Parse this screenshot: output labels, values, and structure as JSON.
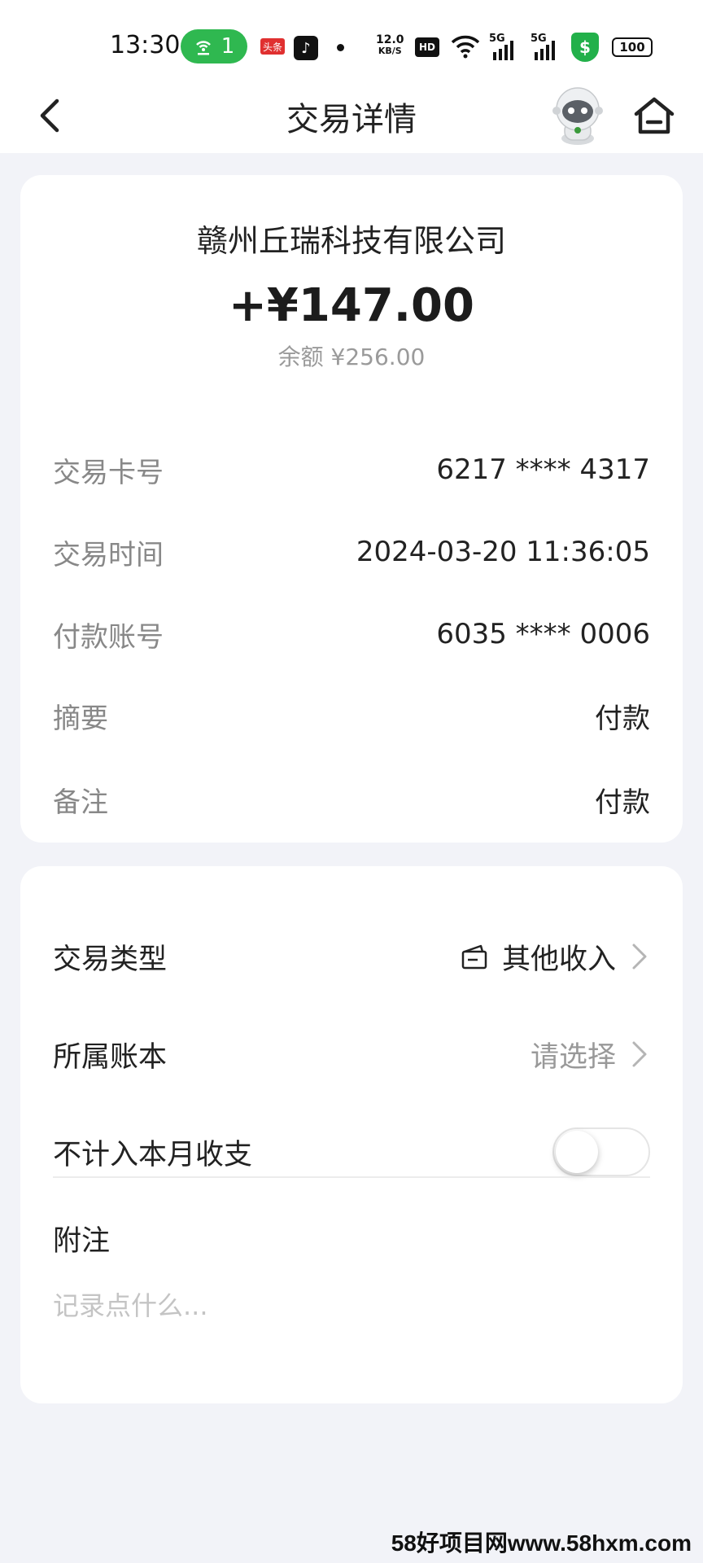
{
  "status_bar": {
    "time": "13:30",
    "pill_count": "1",
    "badge_text": "头条",
    "speed_top": "12.0",
    "speed_bottom": "KB/S",
    "hd_label": "HD",
    "net_label_1": "5G",
    "net_label_2": "5G",
    "shield_symbol": "$",
    "battery": "100",
    "icons": [
      "hotspot-icon",
      "toutiao-icon",
      "tiktok-icon",
      "dot-icon",
      "hd-icon",
      "wifi-icon",
      "signal-icon",
      "signal-icon",
      "shield-icon",
      "battery-icon"
    ]
  },
  "nav": {
    "title": "交易详情",
    "icons": [
      "back-icon",
      "robot-assistant-icon",
      "home-icon"
    ]
  },
  "transaction": {
    "merchant": "赣州丘瑞科技有限公司",
    "amount": "+¥147.00",
    "balance": "余额 ¥256.00",
    "details": [
      {
        "label": "交易卡号",
        "value": "6217 **** 4317"
      },
      {
        "label": "交易时间",
        "value": "2024-03-20 11:36:05"
      },
      {
        "label": "付款账号",
        "value": "6035 **** 0006"
      },
      {
        "label": "摘要",
        "value": "付款"
      },
      {
        "label": "备注",
        "value": "付款"
      }
    ]
  },
  "settings": {
    "type_label": "交易类型",
    "type_value": "其他收入",
    "book_label": "所属账本",
    "book_placeholder": "请选择",
    "exclude_label": "不计入本月收支",
    "exclude_on": false,
    "note_label": "附注",
    "note_placeholder": "记录点什么..."
  },
  "watermark": "58好项目网www.58hxm.com",
  "colors": {
    "background": "#f2f3f8",
    "card": "#ffffff",
    "accent_green": "#2fb850",
    "label_gray": "#888888"
  }
}
